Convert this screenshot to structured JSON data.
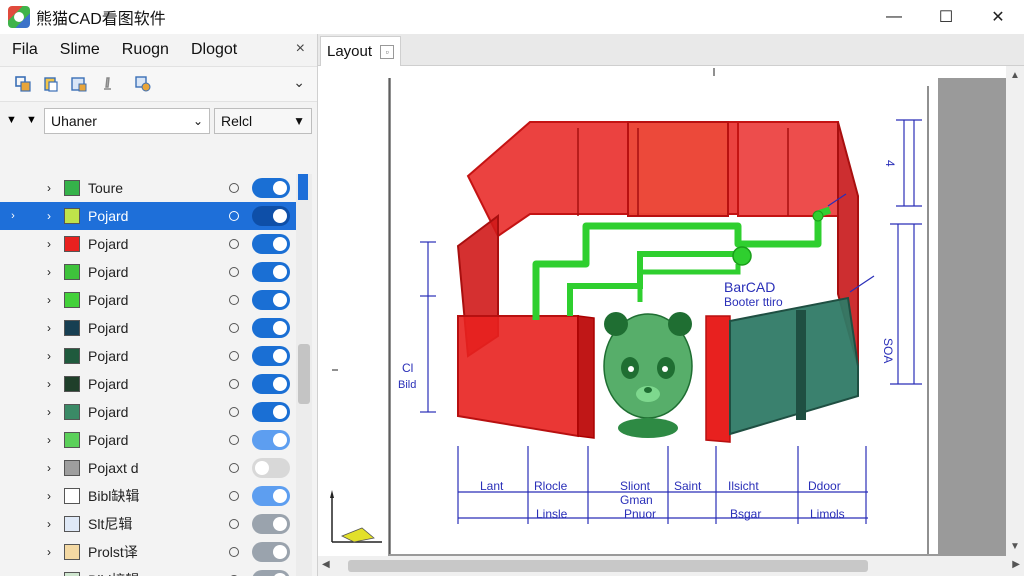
{
  "window": {
    "title": "熊猫CAD看图软件",
    "minimize": "—",
    "maximize": "☐",
    "close": "✕"
  },
  "menu": {
    "items": [
      "Fila",
      "Slime",
      "Ruogn",
      "Dlogot"
    ],
    "panel_close": "×"
  },
  "toolbar": {
    "icons": [
      "layers-copy-icon",
      "layers-paste-icon",
      "layers-save-icon",
      "pin-icon",
      "layer-settings-icon"
    ],
    "overflow": "⌄"
  },
  "filter": {
    "left_value": "Uhaner",
    "right_value": "Relcl"
  },
  "layers": [
    {
      "name": "Toure",
      "color": "#35b24a",
      "toggle": "on"
    },
    {
      "name": "Pojard",
      "color": "#bfe34a",
      "toggle": "on",
      "selected": true
    },
    {
      "name": "Pojard",
      "color": "#e8211f",
      "toggle": "on"
    },
    {
      "name": "Pojard",
      "color": "#3ec23b",
      "toggle": "on"
    },
    {
      "name": "Pojard",
      "color": "#43d13a",
      "toggle": "on"
    },
    {
      "name": "Pojard",
      "color": "#173f52",
      "toggle": "on"
    },
    {
      "name": "Pojard",
      "color": "#1f5a3d",
      "toggle": "on"
    },
    {
      "name": "Pojard",
      "color": "#1f3f2a",
      "toggle": "on"
    },
    {
      "name": "Pojard",
      "color": "#3a8a66",
      "toggle": "on"
    },
    {
      "name": "Pojard",
      "color": "#5bd05a",
      "toggle": "light"
    },
    {
      "name": "Pojaxt d",
      "color": "#9e9e9e",
      "toggle": "off"
    },
    {
      "name": "Bibl缺辑",
      "color": "#ffffff",
      "toggle": "light"
    },
    {
      "name": "Slt尼辑",
      "color": "#dfe9f7",
      "toggle": "gray"
    },
    {
      "name": "Prolst译",
      "color": "#f4d9a3",
      "toggle": "gray"
    },
    {
      "name": "Bibl接辑",
      "color": "#cfe6cf",
      "toggle": "gray"
    }
  ],
  "tabs": [
    {
      "label": "Layout"
    }
  ],
  "drawing": {
    "annotations": {
      "brand": "BarCAD",
      "subtitle": "Booter ttiro",
      "left_dim_a": "Cl",
      "left_dim_b": "Bild",
      "right_dim_a": "4",
      "right_dim_b": "SOA",
      "bottom_labels": [
        "Lant",
        "Rlocle",
        "Sliont",
        "Saint",
        "Ilsicht",
        "Ddoor"
      ],
      "bottom_sub": [
        "Linsle",
        "Gman",
        "Pnuor",
        "Bsgar",
        "Limols"
      ]
    },
    "colors": {
      "wall_red": "#e8211f",
      "pipe_green": "#2fcf2f",
      "panel_teal": "#2f7a66",
      "dim_blue": "#2a2fb8",
      "panda_green": "#3aa050"
    }
  }
}
